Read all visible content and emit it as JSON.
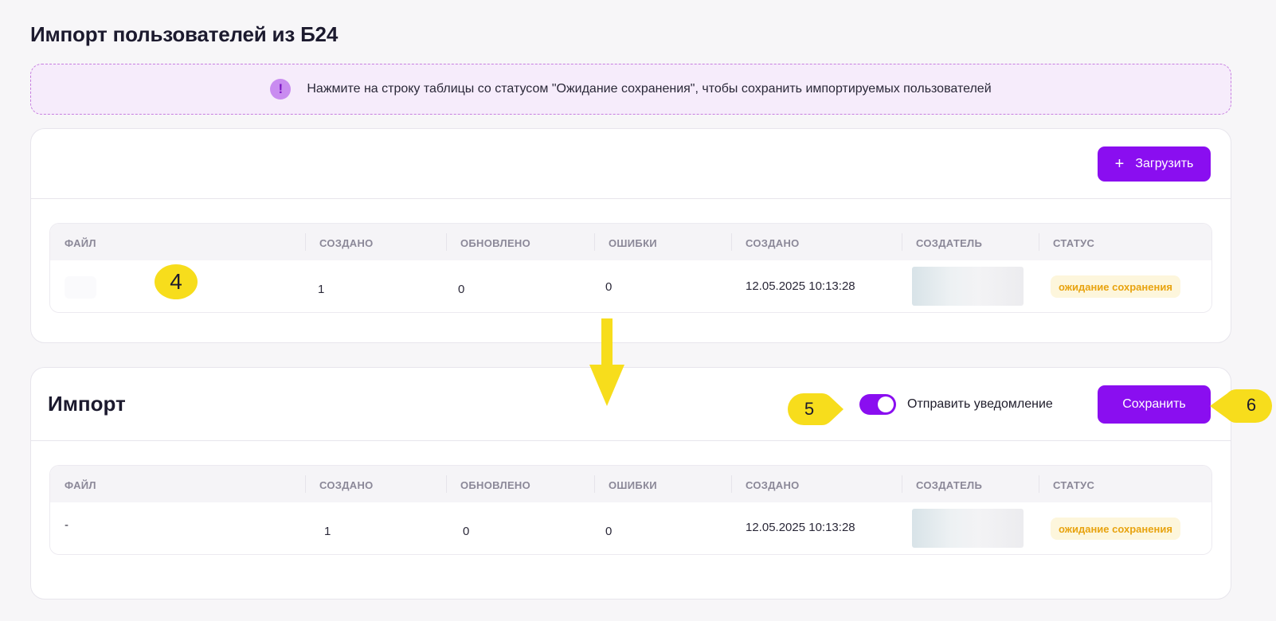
{
  "page": {
    "title": "Импорт пользователей из Б24"
  },
  "banner": {
    "icon": "exclamation-icon",
    "text": "Нажмите на строку таблицы со статусом \"Ожидание сохранения\", чтобы сохранить импортируемых пользователей"
  },
  "upload_card": {
    "upload_button": {
      "icon": "plus-icon",
      "label": "Загрузить"
    },
    "table": {
      "columns": [
        "ФАЙЛ",
        "СОЗДАНО",
        "ОБНОВЛЕНО",
        "ОШИБКИ",
        "СОЗДАНО",
        "СОЗДАТЕЛЬ",
        "СТАТУС"
      ],
      "row": {
        "file": "",
        "created": "1",
        "updated": "0",
        "errors": "0",
        "created_at": "12.05.2025 10:13:28",
        "status": "ожидание сохранения"
      }
    }
  },
  "import_card": {
    "title": "Импорт",
    "notify_toggle": {
      "label": "Отправить уведомление",
      "on": true
    },
    "save_button": {
      "label": "Сохранить"
    },
    "table": {
      "columns": [
        "ФАЙЛ",
        "СОЗДАНО",
        "ОБНОВЛЕНО",
        "ОШИБКИ",
        "СОЗДАНО",
        "СОЗДАТЕЛЬ",
        "СТАТУС"
      ],
      "row": {
        "file": "-",
        "created": "1",
        "updated": "0",
        "errors": "0",
        "created_at": "12.05.2025 10:13:28",
        "status": "ожидание сохранения"
      }
    }
  },
  "annotations": {
    "step_4": "4",
    "step_5": "5",
    "step_6": "6",
    "arrow": "arrow-down-icon"
  },
  "colors": {
    "accent": "#8a0ef0",
    "banner_bg": "#f6ecfb",
    "status_bg": "#fdf6dc",
    "status_text": "#e8a30f",
    "marker": "#f7dd1c"
  }
}
